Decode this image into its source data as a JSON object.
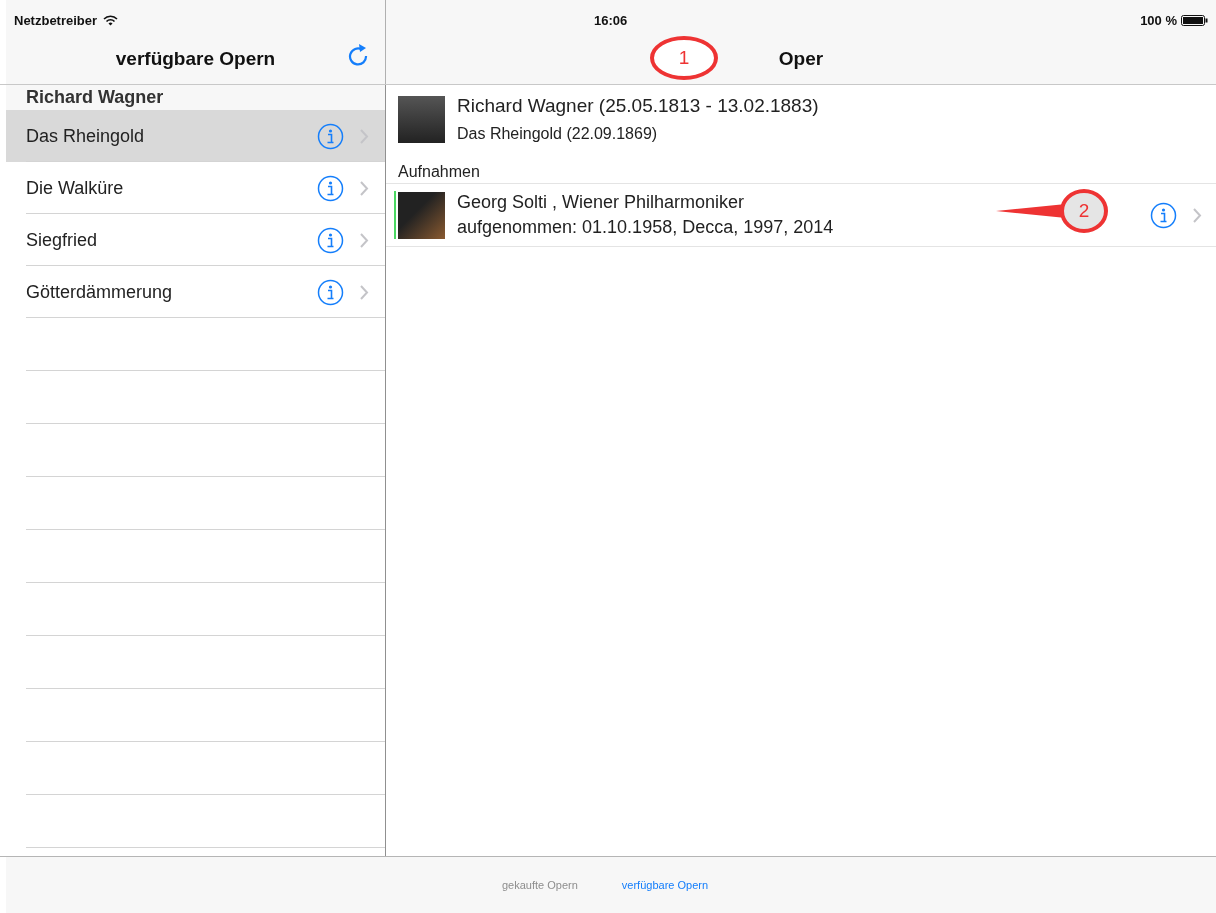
{
  "status_bar": {
    "carrier": "Netzbetreiber",
    "time": "16:06",
    "battery": "100 %"
  },
  "master": {
    "title": "verfügbare Opern",
    "section": "Richard Wagner",
    "items": [
      {
        "label": "Das Rheingold",
        "selected": true
      },
      {
        "label": "Die Walküre",
        "selected": false
      },
      {
        "label": "Siegfried",
        "selected": false
      },
      {
        "label": "Götterdämmerung",
        "selected": false
      }
    ]
  },
  "detail": {
    "title": "Oper",
    "composer": "Richard Wagner (25.05.1813 - 13.02.1883)",
    "opera": "Das Rheingold (22.09.1869)",
    "section": "Aufnahmen",
    "recordings": [
      {
        "title": "Georg Solti , Wiener Philharmoniker",
        "subtitle": "aufgenommen: 01.10.1958, Decca, 1997, 2014"
      }
    ]
  },
  "callouts": [
    {
      "label": "1"
    },
    {
      "label": "2"
    }
  ],
  "tabs": [
    {
      "label": "gekaufte Opern",
      "selected": false
    },
    {
      "label": "verfügbare Opern",
      "selected": true
    }
  ]
}
